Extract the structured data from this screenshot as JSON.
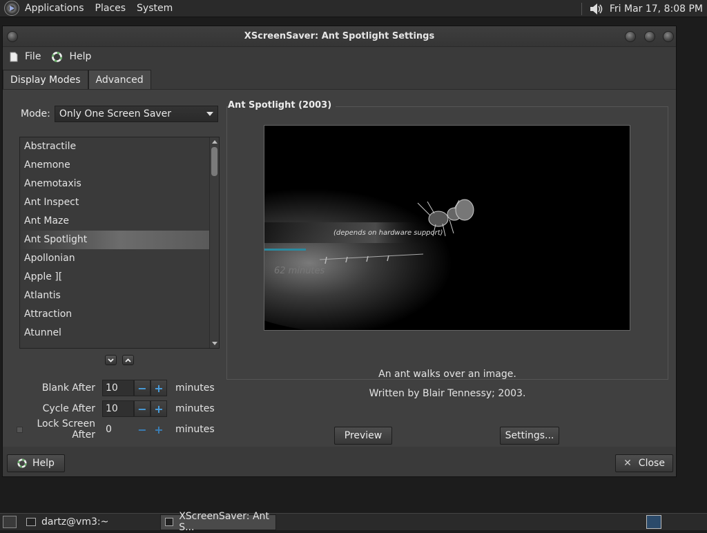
{
  "top_panel": {
    "menus": [
      "Applications",
      "Places",
      "System"
    ],
    "clock": "Fri Mar 17,  8:08 PM"
  },
  "window": {
    "title": "XScreenSaver: Ant Spotlight Settings",
    "menubar": {
      "file": "File",
      "help": "Help"
    },
    "tabs": [
      {
        "label": "Display Modes",
        "active": true
      },
      {
        "label": "Advanced",
        "active": false
      }
    ],
    "mode": {
      "label": "Mode:",
      "value": "Only One Screen Saver"
    },
    "savers": [
      "Abstractile",
      "Anemone",
      "Anemotaxis",
      "Ant Inspect",
      "Ant Maze",
      "Ant Spotlight",
      "Apollonian",
      "Apple ][",
      "Atlantis",
      "Attraction",
      "Atunnel"
    ],
    "selected_saver_index": 5,
    "blank_after": {
      "label": "Blank After",
      "value": "10",
      "unit": "minutes"
    },
    "cycle_after": {
      "label": "Cycle After",
      "value": "10",
      "unit": "minutes"
    },
    "lock_screen_after": {
      "label": "Lock Screen After",
      "value": "0",
      "unit": "minutes",
      "checked": false
    },
    "preview_frame": {
      "title": "Ant Spotlight (2003)",
      "preview_text_1": "(depends on hardware support)",
      "preview_text_2": "62 minutes",
      "description": "An ant walks over an image.",
      "credit": "Written by Blair Tennessy; 2003."
    },
    "buttons": {
      "preview": "Preview",
      "settings": "Settings...",
      "help": "Help",
      "close": "Close"
    }
  },
  "taskbar": {
    "tasks": [
      {
        "label": "dartz@vm3:~",
        "active": false
      },
      {
        "label": "XScreenSaver: Ant S...",
        "active": true
      }
    ]
  },
  "colors": {
    "accent": "#4aa0e0",
    "window_bg": "#404040",
    "panel_bg": "#2a2a2a"
  }
}
